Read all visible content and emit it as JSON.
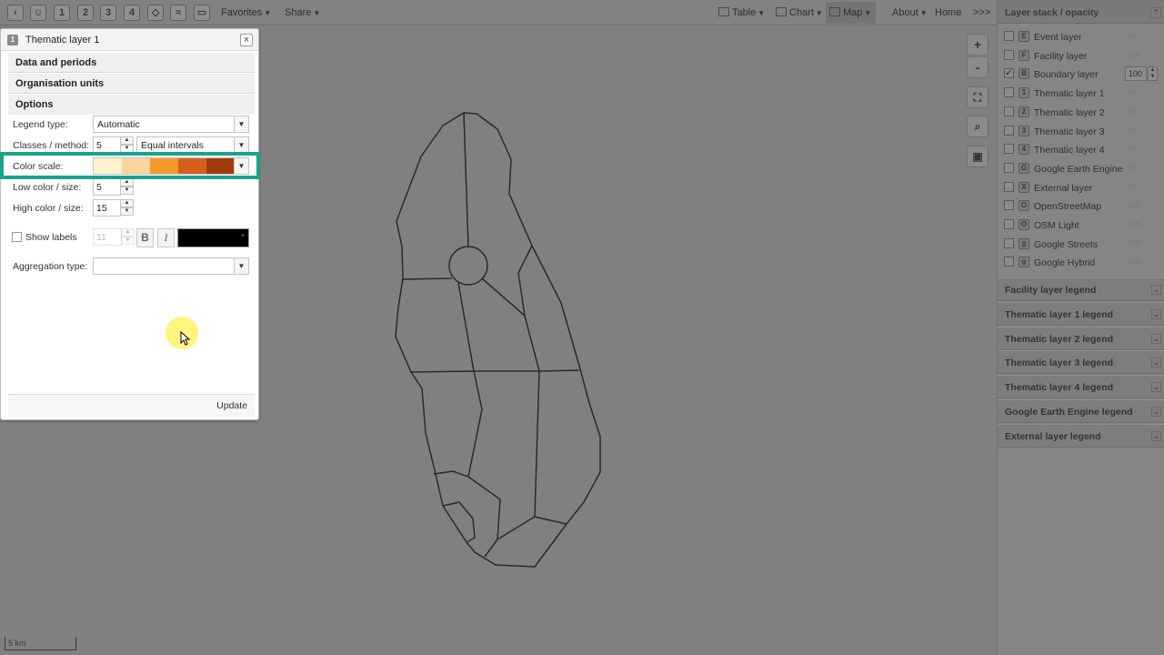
{
  "toolbar": {
    "icon_buttons": [
      "back-icon",
      "user-icon",
      "1",
      "2",
      "3",
      "4",
      "boundary-icon",
      "earth-engine-icon",
      "external-layer-icon"
    ],
    "favorites_label": "Favorites",
    "share_label": "Share",
    "table_label": "Table",
    "chart_label": "Chart",
    "map_label": "Map",
    "about_label": "About",
    "home_label": "Home",
    "more_label": ">>>"
  },
  "map": {
    "zoom_in": "+",
    "zoom_out": "-",
    "scale_label": "5 km"
  },
  "layer_panel": {
    "header": "Layer stack / opacity",
    "layers": [
      {
        "name": "Event layer",
        "icon": "E",
        "checked": false,
        "opacity": "95"
      },
      {
        "name": "Facility layer",
        "icon": "F",
        "checked": false,
        "opacity": "100"
      },
      {
        "name": "Boundary layer",
        "icon": "B",
        "checked": true,
        "opacity": "100"
      },
      {
        "name": "Thematic layer 1",
        "icon": "1",
        "checked": false,
        "opacity": "80"
      },
      {
        "name": "Thematic layer 2",
        "icon": "2",
        "checked": false,
        "opacity": "80"
      },
      {
        "name": "Thematic layer 3",
        "icon": "3",
        "checked": false,
        "opacity": "80"
      },
      {
        "name": "Thematic layer 4",
        "icon": "4",
        "checked": false,
        "opacity": "80"
      },
      {
        "name": "Google Earth Engine",
        "icon": "G",
        "checked": false,
        "opacity": "90"
      },
      {
        "name": "External layer",
        "icon": "X",
        "checked": false,
        "opacity": "90"
      },
      {
        "name": "OpenStreetMap",
        "icon": "O",
        "checked": false,
        "opacity": "100"
      },
      {
        "name": "OSM Light",
        "icon": "O",
        "checked": false,
        "opacity": "100"
      },
      {
        "name": "Google Streets",
        "icon": "g",
        "checked": false,
        "opacity": "100"
      },
      {
        "name": "Google Hybrid",
        "icon": "g",
        "checked": false,
        "opacity": "100"
      }
    ],
    "legends": [
      "Facility layer legend",
      "Thematic layer 1 legend",
      "Thematic layer 2 legend",
      "Thematic layer 3 legend",
      "Thematic layer 4 legend",
      "Google Earth Engine legend",
      "External layer legend"
    ]
  },
  "dialog": {
    "number": "1",
    "title": "Thematic layer 1",
    "close": "×",
    "sections": {
      "data_periods": "Data and periods",
      "org_units": "Organisation units",
      "options": "Options"
    },
    "legend_type_label": "Legend type:",
    "legend_type_value": "Automatic",
    "classes_label": "Classes / method:",
    "classes_value": "5",
    "method_value": "Equal intervals",
    "color_scale_label": "Color scale:",
    "color_scale": [
      "#fff4d0",
      "#fdd49e",
      "#f79a2b",
      "#d6601a",
      "#a03d0c"
    ],
    "low_label": "Low color / size:",
    "low_value": "5",
    "high_label": "High color / size:",
    "high_value": "15",
    "show_labels_label": "Show labels",
    "label_font_size": "11",
    "bold_label": "B",
    "italic_label": "I",
    "label_color": "#000000",
    "aggregation_label": "Aggregation type:",
    "aggregation_value": "",
    "update_label": "Update"
  },
  "colors": {
    "highlight": "#1aa389"
  }
}
